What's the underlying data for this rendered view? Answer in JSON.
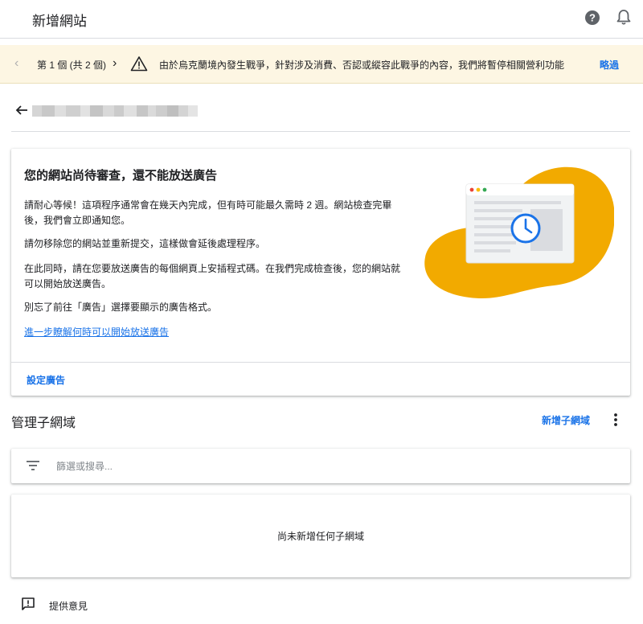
{
  "app": {
    "title": "新增網站"
  },
  "topbar_icons": {
    "help": "help-icon",
    "notifications": "bell-icon"
  },
  "banner": {
    "counter": "第 1 個 (共 2 個)",
    "message": "由於烏克蘭境內發生戰爭，針對涉及消費、否認或縱容此戰爭的內容，我們將暫停相關營利功能",
    "skip_label": "略過"
  },
  "review_card": {
    "title": "您的網站尚待審查，還不能放送廣告",
    "paragraphs": [
      "請耐心等候！這項程序通常會在幾天內完成，但有時可能最久需時 2 週。網站檢查完畢後，我們會立即通知您。",
      "請勿移除您的網站並重新提交，這樣做會延後處理程序。",
      "在此同時，請在您要放送廣告的每個網頁上安插程式碼。在我們完成檢查後，您的網站就可以開始放送廣告。",
      "別忘了前往「廣告」選擇要顯示的廣告格式。"
    ],
    "learn_more_link": "進一步瞭解何時可以開始放送廣告",
    "setup_button": "設定廣告"
  },
  "subdomains": {
    "title": "管理子網域",
    "add_button": "新增子網域",
    "filter_placeholder": "篩選或搜尋...",
    "empty_text": "尚未新增任何子網域"
  },
  "feedback": {
    "label": "提供意見"
  },
  "colors": {
    "accent": "#1a73e8",
    "banner_bg": "#fdf6e3",
    "illustration_blob": "#f2aa00"
  }
}
